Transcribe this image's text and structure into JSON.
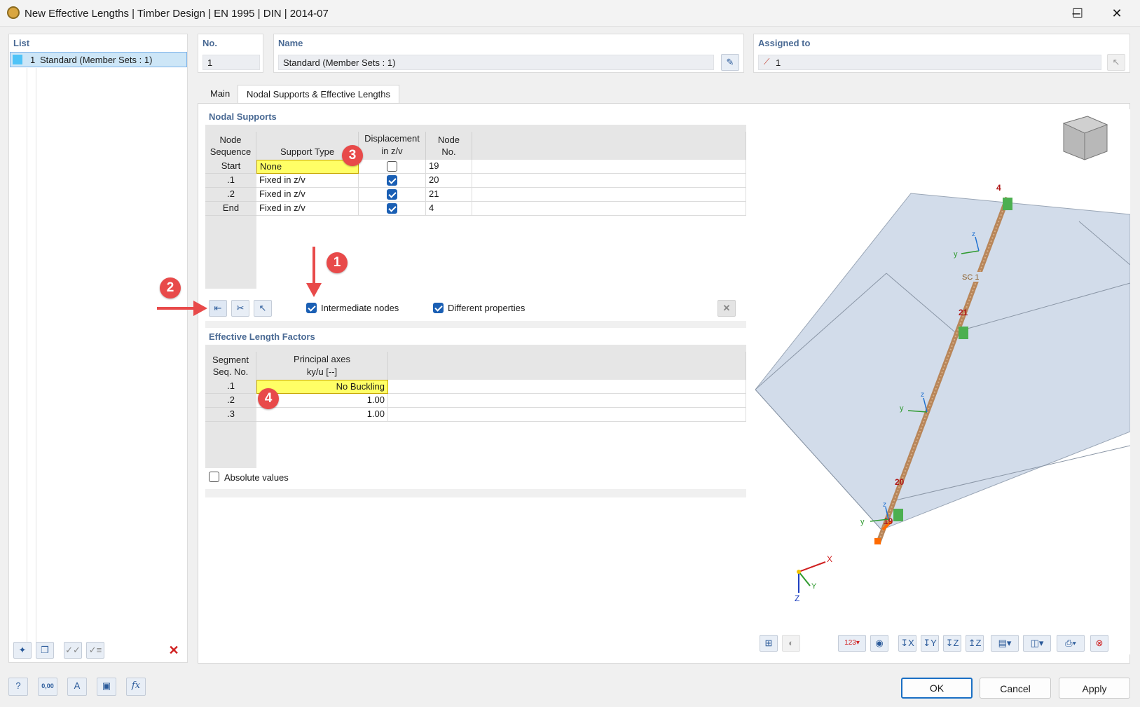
{
  "window": {
    "title": "New Effective Lengths | Timber Design | EN 1995 | DIN | 2014-07"
  },
  "list": {
    "header": "List",
    "items": [
      {
        "no": "1",
        "label": "Standard (Member Sets : 1)"
      }
    ]
  },
  "no": {
    "label": "No.",
    "value": "1"
  },
  "name": {
    "label": "Name",
    "value": "Standard (Member Sets : 1)"
  },
  "assigned": {
    "label": "Assigned to",
    "value": "1"
  },
  "tabs": [
    {
      "label": "Main"
    },
    {
      "label": "Nodal Supports & Effective Lengths"
    }
  ],
  "nodal_supports": {
    "title": "Nodal Supports",
    "headers": {
      "sequence": "Node\nSequence",
      "support_type": "Support Type",
      "displacement": "Displacement\nin z/v",
      "node_no": "Node\nNo."
    },
    "rows": [
      {
        "seq": "Start",
        "type": "None",
        "disp": false,
        "node": "19"
      },
      {
        "seq": ".1",
        "type": "Fixed in z/v",
        "disp": true,
        "node": "20"
      },
      {
        "seq": ".2",
        "type": "Fixed in z/v",
        "disp": true,
        "node": "21"
      },
      {
        "seq": "End",
        "type": "Fixed in z/v",
        "disp": true,
        "node": "4"
      }
    ],
    "intermediate_nodes": {
      "label": "Intermediate nodes",
      "checked": true
    },
    "different_properties": {
      "label": "Different properties",
      "checked": true
    }
  },
  "effective_length": {
    "title": "Effective Length Factors",
    "headers": {
      "segment": "Segment\nSeq. No.",
      "principal": "Principal axes",
      "ky": "ky/u [--]"
    },
    "rows": [
      {
        "seq": ".1",
        "value": "No Buckling"
      },
      {
        "seq": ".2",
        "value": "1.00"
      },
      {
        "seq": ".3",
        "value": "1.00"
      }
    ],
    "absolute_values": {
      "label": "Absolute values",
      "checked": false
    }
  },
  "badges": [
    "1",
    "2",
    "3",
    "4"
  ],
  "view3d": {
    "node_labels": [
      "4",
      "21",
      "20",
      "19"
    ],
    "member_label": "SC 1",
    "axis_labels": {
      "x": "X",
      "y": "Y",
      "z": "Z",
      "local_y": "y",
      "local_z": "z"
    }
  },
  "buttons": {
    "ok": "OK",
    "cancel": "Cancel",
    "apply": "Apply"
  },
  "status_icons": [
    "help-icon",
    "units-icon",
    "text-icon",
    "display-icon",
    "formula-icon"
  ],
  "status_values": {
    "units": "0,00",
    "formula": "fx"
  },
  "colors": {
    "accent": "#1a5fb4",
    "header": "#4a6a94",
    "highlight": "#ffff66",
    "badge": "#e84a4a",
    "member": "#b8865a"
  }
}
